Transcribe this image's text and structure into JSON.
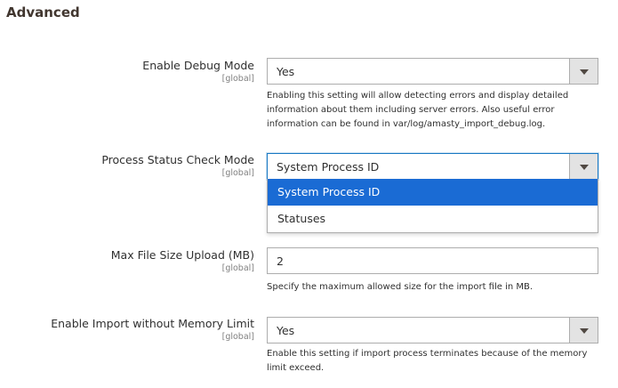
{
  "section": {
    "title": "Advanced"
  },
  "fields": {
    "debug": {
      "label": "Enable Debug Mode",
      "scope": "[global]",
      "value": "Yes",
      "note": "Enabling this setting will allow detecting errors and display detailed information about them including server errors. Also useful error information can be found in var/log/amasty_import_debug.log."
    },
    "process_status": {
      "label": "Process Status Check Mode",
      "scope": "[global]",
      "value": "System Process ID",
      "options": [
        "System Process ID",
        "Statuses"
      ]
    },
    "max_file_size": {
      "label": "Max File Size Upload (MB)",
      "scope": "[global]",
      "value": "2",
      "note": "Specify the maximum allowed size for the import file in MB."
    },
    "memory_limit": {
      "label": "Enable Import without Memory Limit",
      "scope": "[global]",
      "value": "Yes",
      "note": "Enable this setting if import process terminates because of the memory limit exceed."
    }
  },
  "icons": {
    "select_arrow": "chevron-down-icon"
  },
  "colors": {
    "selected_option": "#1a6bd4",
    "focus_border": "#1979c3"
  }
}
